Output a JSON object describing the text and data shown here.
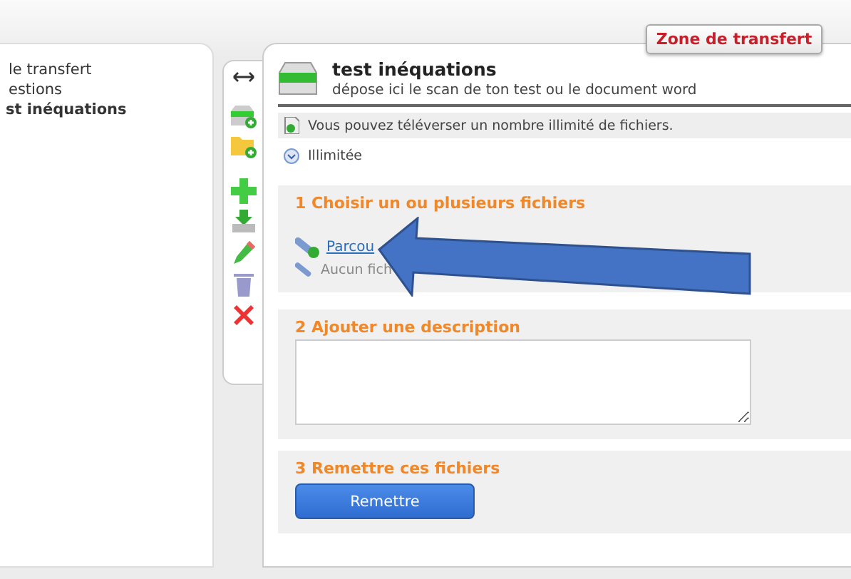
{
  "tree": {
    "items": [
      {
        "label": "le transfert",
        "selected": false
      },
      {
        "label": "estions",
        "selected": false
      },
      {
        "label": "st inéquations",
        "selected": true
      }
    ]
  },
  "zone_button": {
    "label": "Zone de transfert"
  },
  "toolbar": {
    "tools": [
      {
        "kind": "resize"
      },
      {
        "kind": "inbox-add"
      },
      {
        "kind": "folder-add"
      },
      {
        "kind": "plus"
      },
      {
        "kind": "download"
      },
      {
        "kind": "pencil"
      },
      {
        "kind": "trash"
      },
      {
        "kind": "delete"
      }
    ]
  },
  "header": {
    "title": "test inéquations",
    "subtitle": "dépose ici le scan de ton test ou le document word"
  },
  "info": [
    {
      "kind": "upload",
      "text": "Vous pouvez téléverser un nombre illimité de fichiers."
    },
    {
      "kind": "limit",
      "text": "Illimitée"
    }
  ],
  "sections": [
    {
      "kind": "files",
      "title": "1 Choisir un ou plusieurs fichiers",
      "link": "Parcou",
      "status": "Aucun fich"
    },
    {
      "kind": "description",
      "title": "2 Ajouter une description"
    },
    {
      "kind": "submit",
      "title": "3 Remettre ces fichiers",
      "button": "Remettre"
    }
  ]
}
